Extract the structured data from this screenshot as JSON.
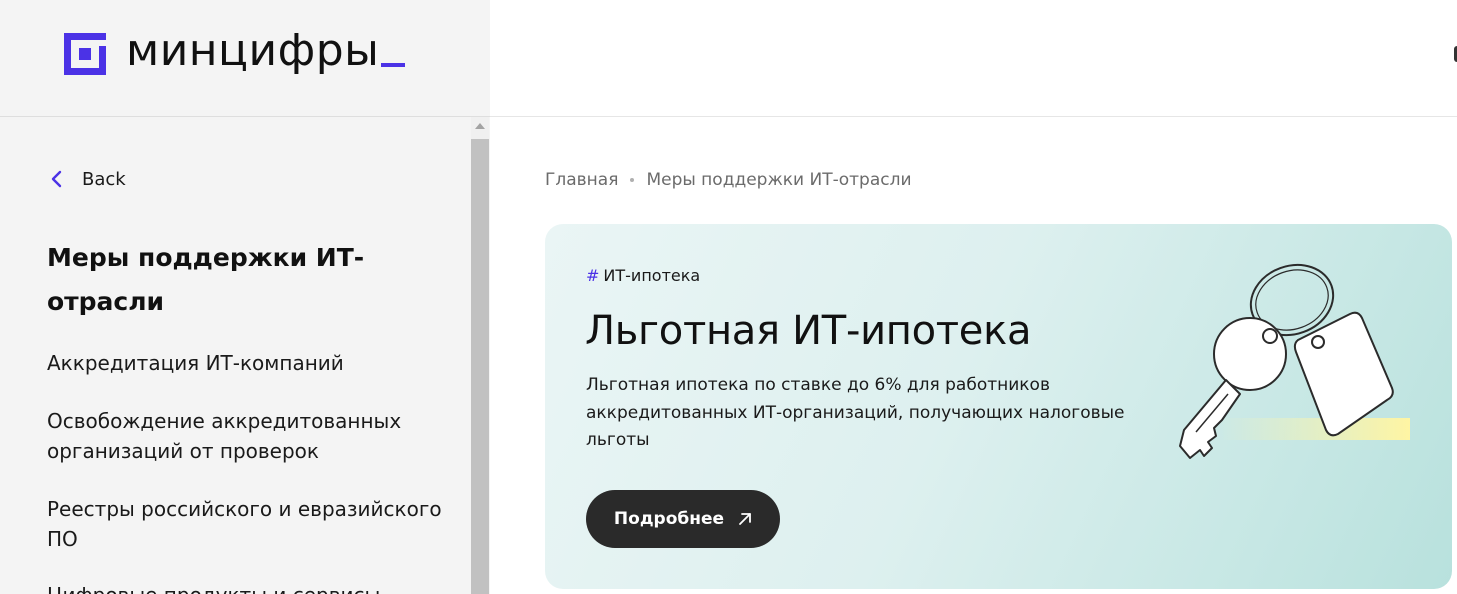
{
  "brand": {
    "name": "минцифры",
    "accent_color": "#4b32e6"
  },
  "sidebar": {
    "back_label": "Back",
    "section_title": "Меры поддержки ИТ-отрасли",
    "items": [
      {
        "label": "Аккредитация ИТ-компаний"
      },
      {
        "label": "Освобождение аккредитованных организаций от проверок"
      },
      {
        "label": "Реестры российского и евразийского ПО"
      },
      {
        "label": "Цифровые продукты и сервисы"
      }
    ]
  },
  "breadcrumb": {
    "home": "Главная",
    "current": "Меры поддержки ИТ-отрасли"
  },
  "promo": {
    "tag": "ИТ-ипотека",
    "title": "Льготная ИТ-ипотека",
    "description": "Льготная ипотека по ставке до 6% для работников аккредитованных ИТ-организаций, получающих налоговые льготы",
    "button_label": "Подробнее",
    "button_icon": "arrow-up-right-icon",
    "illustration": "keys-icon"
  }
}
